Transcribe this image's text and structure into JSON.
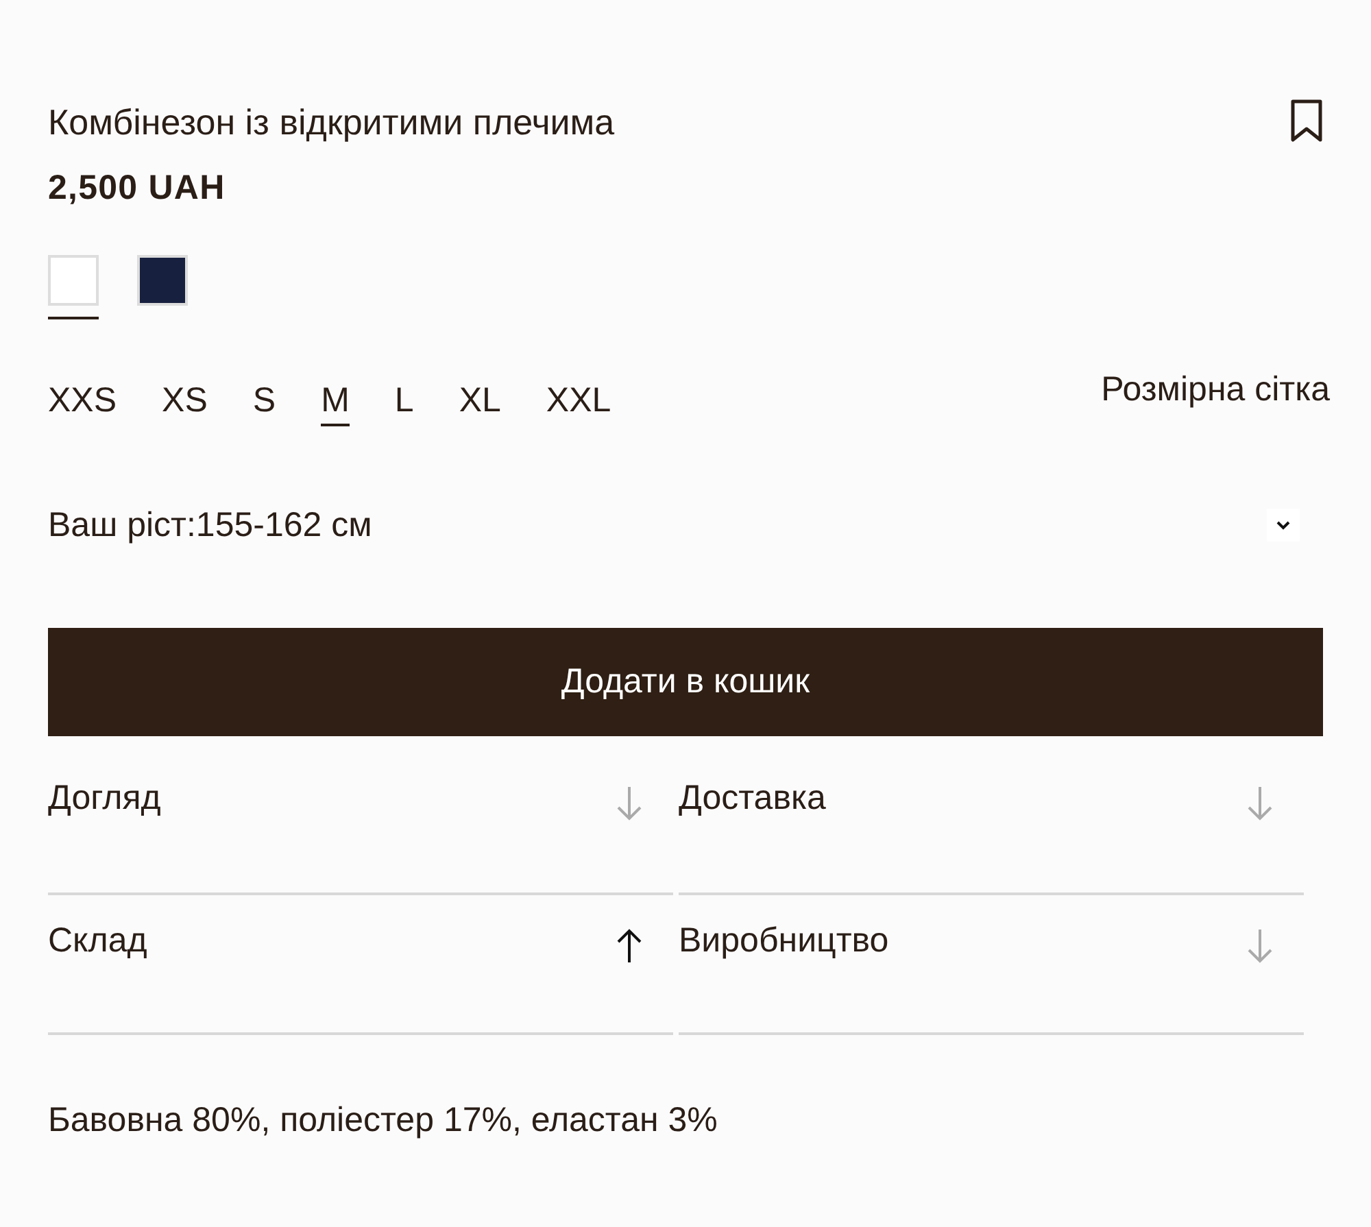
{
  "product": {
    "title": "Комбінезон із відкритими плечима",
    "price": "2,500 UAH",
    "bookmarked": false
  },
  "swatches": [
    {
      "color": "#ffffff",
      "selected": true
    },
    {
      "color": "#182040",
      "selected": false
    }
  ],
  "sizes": [
    {
      "label": "XXS",
      "selected": false
    },
    {
      "label": "XS",
      "selected": false
    },
    {
      "label": "S",
      "selected": false
    },
    {
      "label": "M",
      "selected": true
    },
    {
      "label": "L",
      "selected": false
    },
    {
      "label": "XL",
      "selected": false
    },
    {
      "label": "XXL",
      "selected": false
    }
  ],
  "size_chart_link": "Розмірна сітка",
  "height_select": {
    "value": "Ваш ріст:155-162 см"
  },
  "add_to_cart": "Додати в кошик",
  "accordions": [
    {
      "label": "Догляд",
      "expanded": false
    },
    {
      "label": "Доставка",
      "expanded": false
    },
    {
      "label": "Склад",
      "expanded": true
    },
    {
      "label": "Виробництво",
      "expanded": false
    }
  ],
  "composition": "Бавовна 80%, поліестер 17%, еластан 3%"
}
